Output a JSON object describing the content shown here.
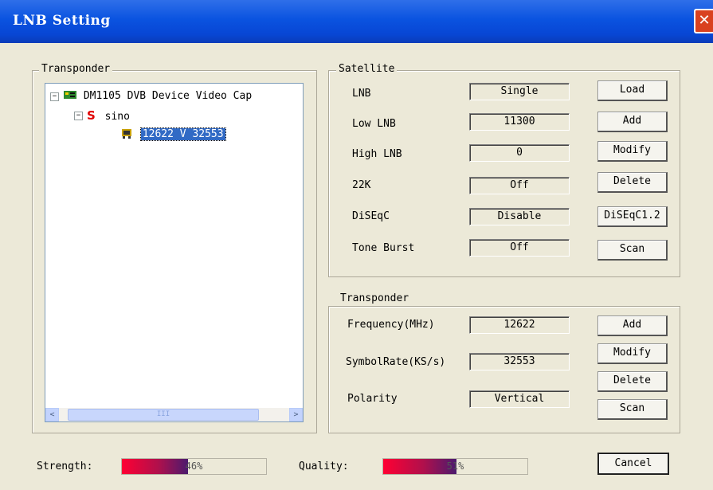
{
  "window": {
    "title": "LNB Setting",
    "close_label": "✕"
  },
  "transponder_panel": {
    "legend": "Transponder",
    "tree": {
      "device": "DM1105 DVB Device Video Cap",
      "satellite": "sino",
      "satellite_mark": "S",
      "transponder": "12622 V 32553",
      "expander_minus": "−"
    },
    "scroll_left": "<",
    "scroll_right": ">",
    "thumb_grip": "III"
  },
  "satellite": {
    "legend": "Satellite",
    "rows": [
      {
        "label": "LNB",
        "value": "Single"
      },
      {
        "label": "Low LNB",
        "value": "11300"
      },
      {
        "label": "High LNB",
        "value": "0"
      },
      {
        "label": "22K",
        "value": "Off"
      },
      {
        "label": "DiSEqC",
        "value": "Disable"
      },
      {
        "label": "Tone Burst",
        "value": "Off"
      }
    ],
    "buttons": [
      "Load",
      "Add",
      "Modify",
      "Delete",
      "DiSEqC1.2",
      "Scan"
    ]
  },
  "transponder": {
    "legend": "Transponder",
    "rows": [
      {
        "label": "Frequency(MHz)",
        "value": "12622"
      },
      {
        "label": "SymbolRate(KS/s)",
        "value": "32553"
      },
      {
        "label": "Polarity",
        "value": "Vertical"
      }
    ],
    "buttons": [
      "Add",
      "Modify",
      "Delete",
      "Scan"
    ]
  },
  "status": {
    "strength_label": "Strength:",
    "strength_value": 46,
    "strength_text": "46%",
    "quality_label": "Quality:",
    "quality_value": 51,
    "quality_text": "51%"
  },
  "footer": {
    "cancel_label": "Cancel"
  },
  "colors": {
    "titlebar": "#0a53e0",
    "selection": "#316ac5",
    "meter_start": "#ff0033",
    "meter_end": "#4b1a6e"
  }
}
